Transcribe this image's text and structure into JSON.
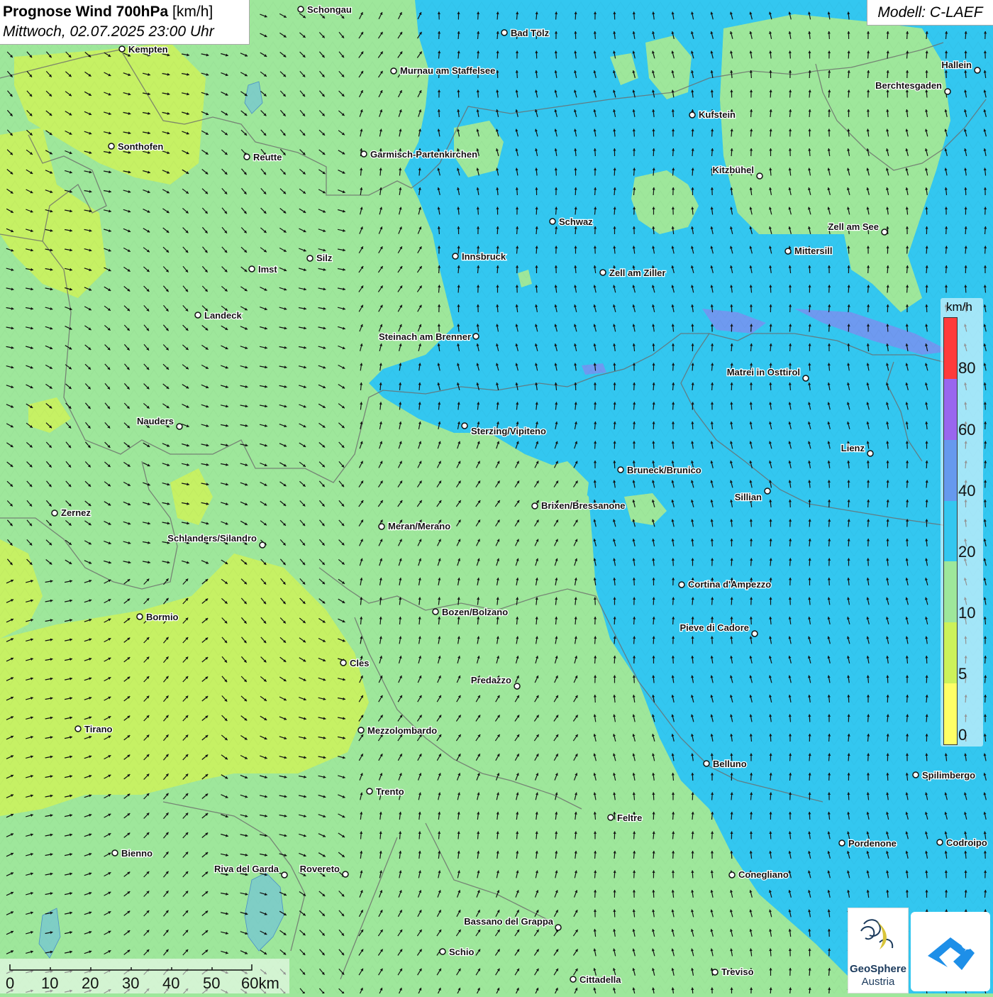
{
  "header": {
    "title_bold": "Prognose Wind 700hPa",
    "title_unit": "[km/h]",
    "datetime": "Mittwoch, 02.07.2025 23:00 Uhr",
    "model": "Modell: C-LAEF"
  },
  "legend": {
    "unit": "km/h",
    "colors": [
      "#ff3b3b",
      "#9966ee",
      "#6699ee",
      "#33c7f0",
      "#9ee79b",
      "#ccf25a",
      "#ffff66"
    ],
    "labels": [
      "80",
      "60",
      "40",
      "20",
      "10",
      "5",
      "0"
    ]
  },
  "scale": {
    "labels": [
      "0",
      "10",
      "20",
      "30",
      "40",
      "50",
      "60km"
    ]
  },
  "logo": {
    "name": "GeoSphere",
    "subtitle": "Austria"
  },
  "map": {
    "colors": {
      "green": "#9ee79b",
      "yellow_green": "#ccf25a",
      "blue": "#33c7f0",
      "violet": "#7d8ef0",
      "border": "#777777"
    },
    "cities": [
      {
        "name": "Schongau"
      },
      {
        "name": "Bad Tölz"
      },
      {
        "name": "Kempten"
      },
      {
        "name": "Murnau am Staffelsee"
      },
      {
        "name": "Hallein"
      },
      {
        "name": "Berchtesgaden"
      },
      {
        "name": "Kufstein"
      },
      {
        "name": "Sonthofen"
      },
      {
        "name": "Reutte"
      },
      {
        "name": "Garmisch-Partenkirchen"
      },
      {
        "name": "Kitzbühel"
      },
      {
        "name": "Schwaz"
      },
      {
        "name": "Zell am See"
      },
      {
        "name": "Innsbruck"
      },
      {
        "name": "Mittersill"
      },
      {
        "name": "Silz"
      },
      {
        "name": "Imst"
      },
      {
        "name": "Zell am Ziller"
      },
      {
        "name": "Landeck"
      },
      {
        "name": "Steinach am Brenner"
      },
      {
        "name": "Matrei in Osttirol"
      },
      {
        "name": "Nauders"
      },
      {
        "name": "Sterzing/Vipiteno"
      },
      {
        "name": "Lienz"
      },
      {
        "name": "Bruneck/Brunico"
      },
      {
        "name": "Sillian"
      },
      {
        "name": "Brixen/Bressanone"
      },
      {
        "name": "Zernez"
      },
      {
        "name": "Meran/Merano"
      },
      {
        "name": "Schlanders/Silandro"
      },
      {
        "name": "Cortina d'Ampezzo"
      },
      {
        "name": "Bozen/Bolzano"
      },
      {
        "name": "Bormio"
      },
      {
        "name": "Pieve di Cadore"
      },
      {
        "name": "Cles"
      },
      {
        "name": "Predazzo"
      },
      {
        "name": "Tirano"
      },
      {
        "name": "Mezzolombardo"
      },
      {
        "name": "Belluno"
      },
      {
        "name": "Spilimbergo"
      },
      {
        "name": "Trento"
      },
      {
        "name": "Feltre"
      },
      {
        "name": "Pordenone"
      },
      {
        "name": "Codroipo"
      },
      {
        "name": "Bienno"
      },
      {
        "name": "Riva del Garda"
      },
      {
        "name": "Rovereto"
      },
      {
        "name": "Conegliano"
      },
      {
        "name": "Bassano del Grappa"
      },
      {
        "name": "Schio"
      },
      {
        "name": "Treviso"
      },
      {
        "name": "Cittadella"
      }
    ]
  }
}
